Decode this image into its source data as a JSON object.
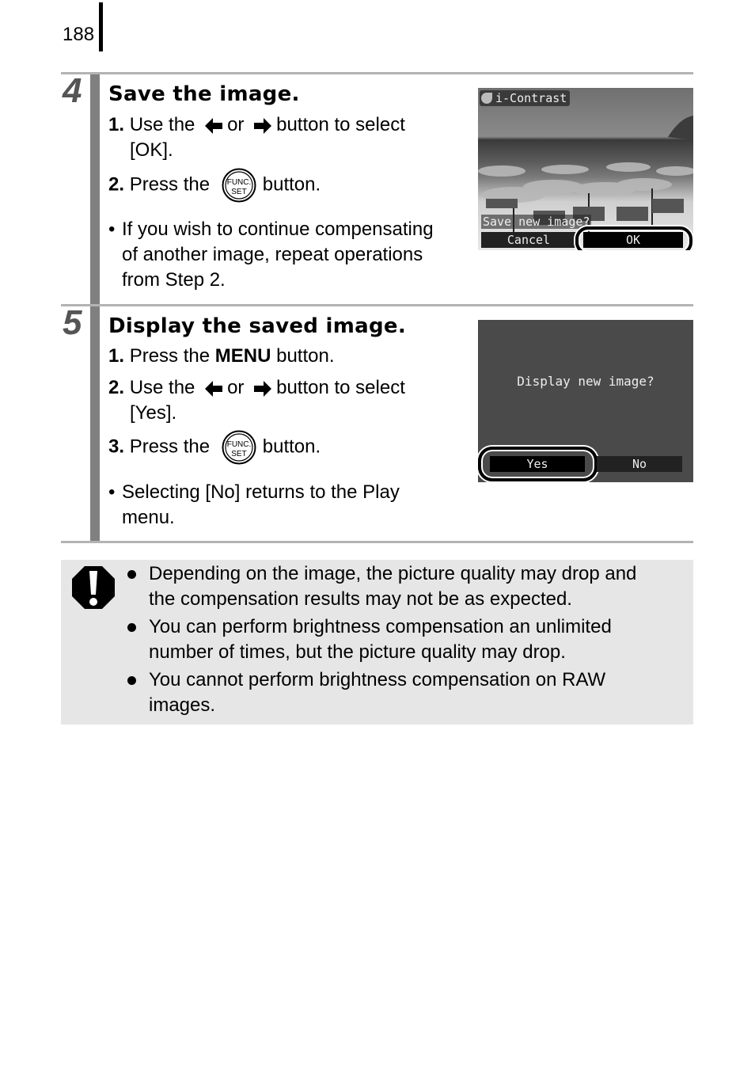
{
  "page_number": "188",
  "steps": [
    {
      "number": "4",
      "title": "Save the image.",
      "instructions": [
        {
          "num": "1.",
          "pre": "Use the",
          "mid": "or",
          "post": "button to select",
          "cont": "[OK]."
        },
        {
          "num": "2.",
          "pre": "Press the",
          "post": "button."
        }
      ],
      "bullet": [
        "If you wish to continue compensating",
        "of another image, repeat operations",
        "from Step 2."
      ],
      "screen": {
        "mode_label": "i-Contrast",
        "prompt": "Save new image?",
        "options": [
          "Cancel",
          "OK"
        ],
        "selected": "OK"
      }
    },
    {
      "number": "5",
      "title": "Display the saved image.",
      "instructions": [
        {
          "num": "1.",
          "pre": "Press the",
          "bold": "MENU",
          "post": "button."
        },
        {
          "num": "2.",
          "pre": "Use the",
          "mid": "or",
          "post": "button to select",
          "cont": "[Yes]."
        },
        {
          "num": "3.",
          "pre": "Press the",
          "post": "button."
        }
      ],
      "bullet": [
        "Selecting [No] returns to the Play",
        "menu."
      ],
      "screen": {
        "prompt": "Display new image?",
        "options": [
          "Yes",
          "No"
        ],
        "selected": "Yes"
      }
    }
  ],
  "func_button": {
    "top": "FUNC.",
    "bottom": "SET"
  },
  "bullet_char": "•",
  "cautions": [
    [
      "Depending on the image, the picture quality may drop and",
      "the compensation results may not be as expected."
    ],
    [
      "You can perform brightness compensation an unlimited",
      "number of times, but the picture quality may drop."
    ],
    [
      "You cannot perform brightness compensation on RAW",
      "images."
    ]
  ]
}
